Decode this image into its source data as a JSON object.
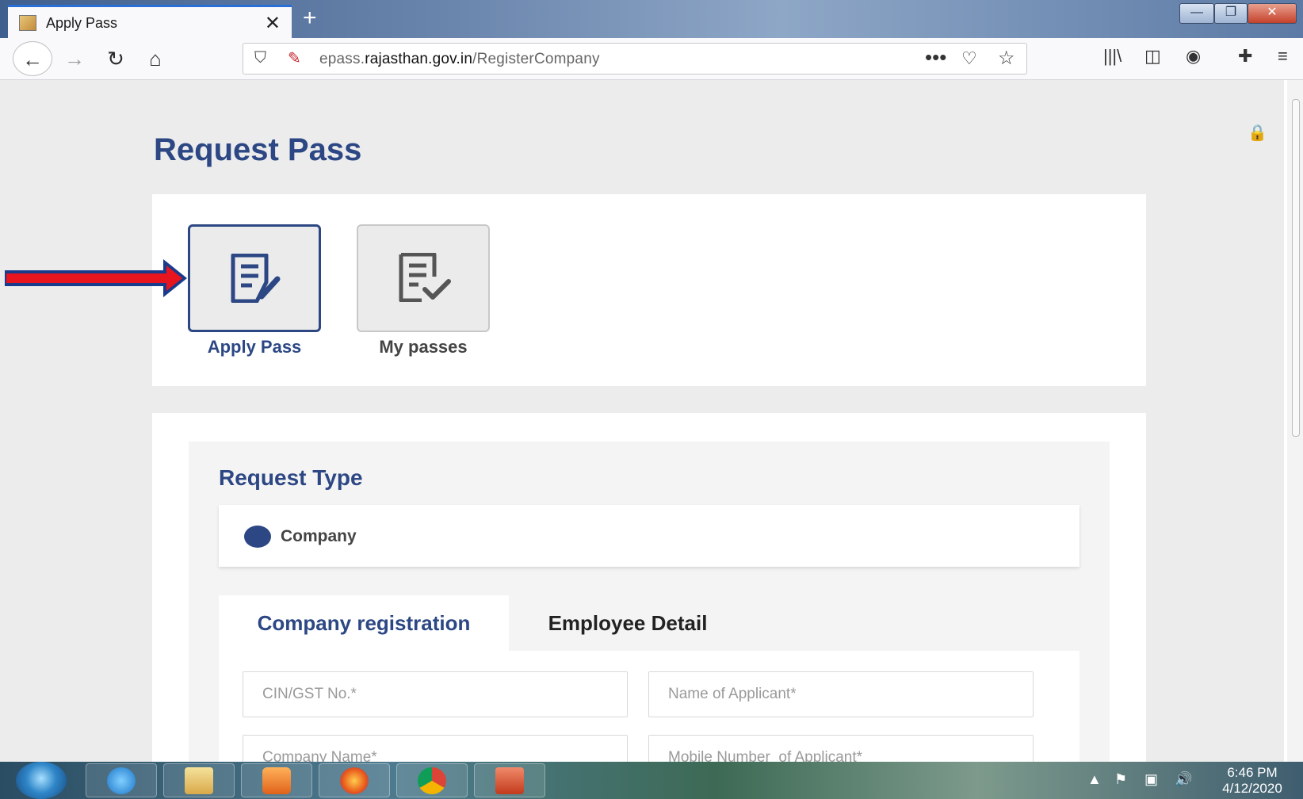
{
  "browser": {
    "tab_title": "Apply Pass",
    "tab_close": "✕",
    "new_tab": "+",
    "url_domain_prefix": "epass.",
    "url_domain": "rajasthan.gov.in",
    "url_path": "/RegisterCompany",
    "more_glyph": "•••"
  },
  "page": {
    "heading": "Request Pass",
    "tiles": [
      {
        "label": "Apply Pass",
        "icon": "document-edit-icon",
        "selected": true
      },
      {
        "label": "My passes",
        "icon": "document-check-icon",
        "selected": false
      }
    ],
    "request_type": {
      "title": "Request Type",
      "option": "Company",
      "selected": true
    },
    "form_tabs": [
      {
        "label": "Company registration",
        "active": true
      },
      {
        "label": "Employee Detail",
        "active": false
      }
    ],
    "fields": [
      {
        "placeholder": "CIN/GST No.*"
      },
      {
        "placeholder": "Name of Applicant*"
      },
      {
        "placeholder": "Company Name*"
      },
      {
        "placeholder": "Mobile Number  of Applicant*"
      }
    ],
    "annotation_arrow_color": "#e8141e"
  },
  "taskbar": {
    "apps": [
      "internet-explorer-icon",
      "file-explorer-icon",
      "media-player-icon",
      "firefox-icon",
      "chrome-icon",
      "powerpoint-icon"
    ],
    "time": "6:46 PM",
    "date": "4/12/2020"
  },
  "colors": {
    "accent": "#2c4784",
    "page_bg": "#ececec"
  }
}
